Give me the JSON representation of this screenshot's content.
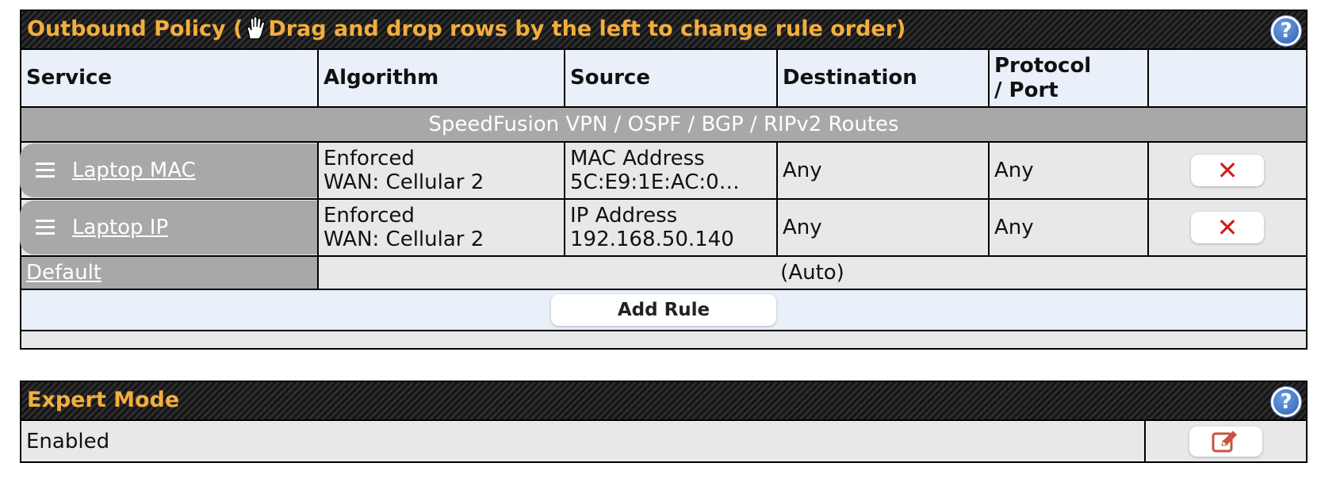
{
  "outbound": {
    "title_before_icon": "Outbound Policy (",
    "title_after_icon": "Drag and drop rows by the left to change rule order)",
    "help": "?",
    "columns": {
      "service": "Service",
      "algorithm": "Algorithm",
      "source": "Source",
      "destination": "Destination",
      "protocol_line1": "Protocol",
      "protocol_line2": "/ Port"
    },
    "section_label": "SpeedFusion VPN / OSPF / BGP / RIPv2 Routes",
    "rules": [
      {
        "service": "Laptop MAC",
        "algorithm_line1": "Enforced",
        "algorithm_line2": "WAN: Cellular 2",
        "source_line1": "MAC Address",
        "source_line2": "5C:E9:1E:AC:0…",
        "destination": "Any",
        "protocol": "Any",
        "delete": "✕"
      },
      {
        "service": "Laptop IP",
        "algorithm_line1": "Enforced",
        "algorithm_line2": "WAN: Cellular 2",
        "source_line1": "IP Address",
        "source_line2": "192.168.50.140",
        "destination": "Any",
        "protocol": "Any",
        "delete": "✕"
      }
    ],
    "default_label": "Default",
    "default_value": "(Auto)",
    "add_rule_label": "Add Rule"
  },
  "expert": {
    "title": "Expert Mode",
    "help": "?",
    "value": "Enabled"
  },
  "colors": {
    "title_orange": "#f2ae3e",
    "header_bg": "#e9f0fa",
    "grey_cell": "#a8a8a8",
    "row_bg": "#e8e8ea",
    "delete_red": "#d21c1c",
    "edit_icon": "#c9533d",
    "help_blue": "#3a6fc4"
  },
  "icons": {
    "drag": "hand-drag-icon",
    "help": "help-icon",
    "delete": "close-icon",
    "edit": "edit-icon",
    "handle": "drag-handle-icon"
  }
}
